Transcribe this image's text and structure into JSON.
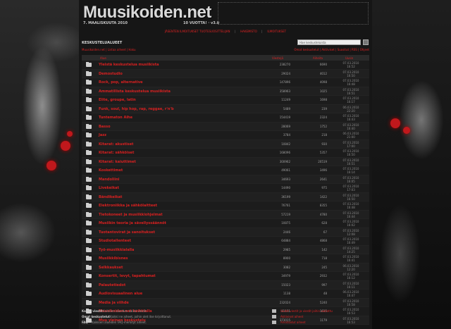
{
  "header": {
    "logo": "Muusikoiden.net",
    "date": "7. MAALISKUUTA 2010",
    "years": "10 VUOTTA! · v3.0"
  },
  "toplinks": [
    "JÄSENTEN ILMOITUKSET TUOTESUOSITTELIJAN",
    "HAKEMISTO",
    "ILMOITUKSET"
  ],
  "section": {
    "heading": "KESKUSTELUALUEET",
    "search_placeholder": "Hae keskusteluista",
    "breadcrumb": "Muusikoiden.net | Listaa aiheet | Haku",
    "right_links": "Omat keskustelut | Aktiiviset | Suositut | RSS | Ohjeet"
  },
  "columns": {
    "name": "Alue",
    "c1": "Viestejä",
    "c2": "Aiheita",
    "c3": "Uusin"
  },
  "forums": [
    {
      "name": "Yleistä keskustelua musiikista",
      "c1": "238270",
      "c2": "6690",
      "d": "07.03.2010",
      "t": "16:52"
    },
    {
      "name": "Demostudio",
      "c1": "29024",
      "c2": "4012",
      "d": "07.03.2010",
      "t": "16:50"
    },
    {
      "name": "Rock, pop, alternative",
      "c1": "147896",
      "c2": "4098",
      "d": "07.03.2010",
      "t": "16:48"
    },
    {
      "name": "Ammatillista keskustelua musiikista",
      "c1": "358963",
      "c2": "1025",
      "d": "07.03.2010",
      "t": "16:51"
    },
    {
      "name": "Elite, groupe, latin",
      "c1": "11249",
      "c2": "1698",
      "d": "07.03.2010",
      "t": "16:17"
    },
    {
      "name": "Funk, soul, hip hop, rap, reggae, r'n'b",
      "c1": "5489",
      "c2": "239",
      "d": "06.03.2010",
      "t": "22:20"
    },
    {
      "name": "Tuntematon Aihe",
      "c1": "154419",
      "c2": "2324",
      "d": "07.03.2010",
      "t": "16:43"
    },
    {
      "name": "Basso",
      "c1": "28069",
      "c2": "1752",
      "d": "07.03.2010",
      "t": "16:40"
    },
    {
      "name": "Jazz",
      "c1": "3784",
      "c2": "218",
      "d": "06.03.2010",
      "t": "21:00"
    },
    {
      "name": "Kitarat: akustiset",
      "c1": "10842",
      "c2": "930",
      "d": "07.03.2010",
      "t": "17:00"
    },
    {
      "name": "Kitarat: sähköiset",
      "c1": "168096",
      "c2": "5357",
      "d": "07.03.2010",
      "t": "16:50"
    },
    {
      "name": "Kitarat: kaiuttimet",
      "c1": "300962",
      "c2": "20519",
      "d": "07.03.2010",
      "t": "16:51"
    },
    {
      "name": "Koskettimet",
      "c1": "49061",
      "c2": "3496",
      "d": "07.03.2010",
      "t": "16:14"
    },
    {
      "name": "Mandoliini",
      "c1": "34693",
      "c2": "2641",
      "d": "07.03.2010",
      "t": "16:05"
    },
    {
      "name": "Livekeikat",
      "c1": "14490",
      "c2": "975",
      "d": "07.03.2010",
      "t": "17:03"
    },
    {
      "name": "Bändikeikat",
      "c1": "36199",
      "c2": "1422",
      "d": "07.03.2010",
      "t": "16:50"
    },
    {
      "name": "Elektroniikka ja sähkölaitteet",
      "c1": "76761",
      "c2": "8355",
      "d": "07.03.2010",
      "t": "16:48"
    },
    {
      "name": "Tietokoneet ja musiikkiohjelmat",
      "c1": "57219",
      "c2": "4780",
      "d": "07.03.2010",
      "t": "16:44"
    },
    {
      "name": "Musiikin teoria ja sävellyssäännöt",
      "c1": "10875",
      "c2": "628",
      "d": "07.03.2010",
      "t": "16:02"
    },
    {
      "name": "Tuotantovirat ja sanoitukset",
      "c1": "2446",
      "c2": "67",
      "d": "07.03.2010",
      "t": "12:08"
    },
    {
      "name": "Studiotallenteet",
      "c1": "64884",
      "c2": "4868",
      "d": "07.03.2010",
      "t": "16:49"
    },
    {
      "name": "Työ-musiikkialalla",
      "c1": "2985",
      "c2": "142",
      "d": "07.03.2010",
      "t": "14:25"
    },
    {
      "name": "Musiikkibisnes",
      "c1": "8900",
      "c2": "718",
      "d": "07.03.2010",
      "t": "16:41"
    },
    {
      "name": "Selkkaukset",
      "c1": "3082",
      "c2": "245",
      "d": "06.03.2010",
      "t": "12:20"
    },
    {
      "name": "Konsertit, levyt, tapahtumat",
      "c1": "34979",
      "c2": "2932",
      "d": "07.03.2010",
      "t": "16:12"
    },
    {
      "name": "Palautetiedot",
      "c1": "15023",
      "c2": "997",
      "d": "07.03.2010",
      "t": "16:11"
    },
    {
      "name": "Audiovisuaalinen alue",
      "c1": "1138",
      "c2": "48",
      "d": "06.03.2010",
      "t": "16:47"
    },
    {
      "name": "Media ja viihde",
      "c1": "232024",
      "c2": "5240",
      "d": "07.03.2010",
      "t": "16:58"
    },
    {
      "name": "Muusikoiden.net kaikkialla",
      "c1": "81151",
      "c2": "1615",
      "d": "07.03.2010",
      "t": "16:53"
    },
    {
      "name": "Muu yleinen keskustelu",
      "c1": "373015",
      "c2": "1179",
      "d": "07.03.2010",
      "t": "16:53"
    }
  ],
  "footer": [
    {
      "label": "Kaikki viestit",
      "text": "Kaikkien alueiden kaikki viestit.",
      "right": "Uudet viestit ja viestit joihin vastattu"
    },
    {
      "label": "Omat keskustelut",
      "text": "Kaikki ne aiheet, joihin olet itse kirjoittanut.",
      "right": "Aktiiviset aiheet"
    },
    {
      "label": "FAQ",
      "text": "Kaikkien alueiden FAQ-merkityt aiheet.",
      "right": "Arkistoidut aiheet"
    }
  ]
}
